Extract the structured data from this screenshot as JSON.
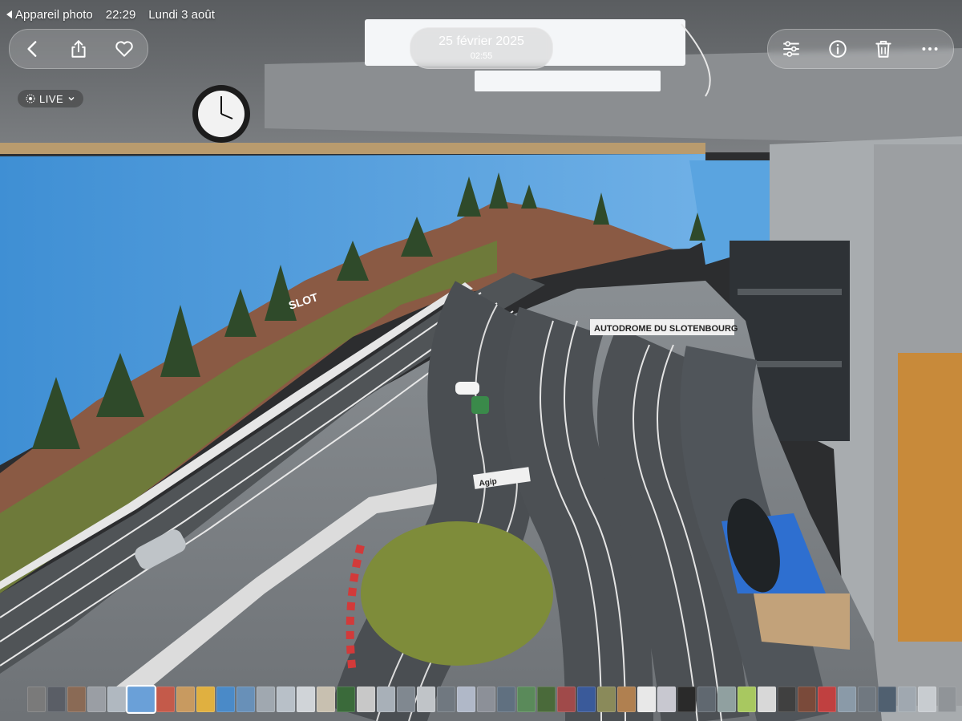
{
  "status_bar": {
    "back_app": "Appareil photo",
    "time": "22:29",
    "date": "Lundi 3 août"
  },
  "header": {
    "date": "25 février 2025",
    "time": "02:55"
  },
  "live_badge": {
    "label": "LIVE"
  },
  "icons": {
    "back": "chevron-left-icon",
    "share": "share-icon",
    "favorite": "heart-icon",
    "adjust": "sliders-icon",
    "info": "info-icon",
    "delete": "trash-icon",
    "more": "more-icon"
  },
  "photo": {
    "banner_text": "AUTODROME DU SLOTENBOURG",
    "hill_sign": "SLOT",
    "barrier_brand": "Agip"
  },
  "thumbnails": {
    "colors": [
      "#7a7a7a",
      "#5a5e66",
      "#8a6a55",
      "#9a9ea4",
      "#b0b8c0",
      "#6aa0d8",
      "#c45a4a",
      "#c89a60",
      "#e0b040",
      "#4a8ac8",
      "#6890b8",
      "#a0a8b0",
      "#b8c0c8",
      "#d0d4d8",
      "#c8c0b0",
      "#3a6a3a",
      "#c8c8c8",
      "#a8b0b8",
      "#808890",
      "#c0c4c8",
      "#707880",
      "#b0b8c8",
      "#8c9098",
      "#607080",
      "#5a8a5a",
      "#4a6a3a",
      "#a04a4a",
      "#3a5a9a",
      "#8a8a5a",
      "#b08050",
      "#e8e8e8",
      "#c8c8d0",
      "#2a2a2a",
      "#606870",
      "#90a0a0",
      "#a8c860",
      "#d8d8d8",
      "#404040",
      "#7a4a3a",
      "#c04040",
      "#8a9aa8",
      "#707880",
      "#506070",
      "#a0a8b0",
      "#c8ccd0",
      "#909498"
    ],
    "current_index": 5
  }
}
